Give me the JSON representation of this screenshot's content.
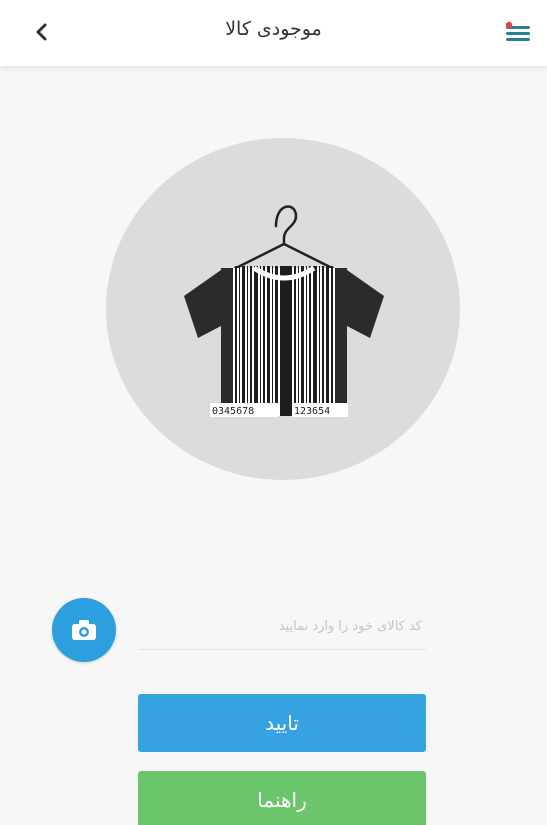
{
  "header": {
    "title": "موجودی کالا",
    "back_icon": "chevron-left-icon",
    "menu_icon": "menu-icon"
  },
  "illustration": {
    "icon": "barcode-shirt-icon",
    "barcode_left": "0345678",
    "barcode_right": "123654"
  },
  "form": {
    "camera_icon": "camera-icon",
    "code_placeholder": "کد کالای خود را وارد نمایید",
    "code_value": ""
  },
  "actions": {
    "confirm_label": "تایید",
    "guide_label": "راهنما"
  },
  "colors": {
    "accent_blue": "#36a3e0",
    "camera_blue": "#2d9fde",
    "guide_green": "#6cc56b",
    "circle_gray": "#dcdcdc",
    "menu_icon": "#2a7f96",
    "menu_dot": "#e0404a"
  }
}
